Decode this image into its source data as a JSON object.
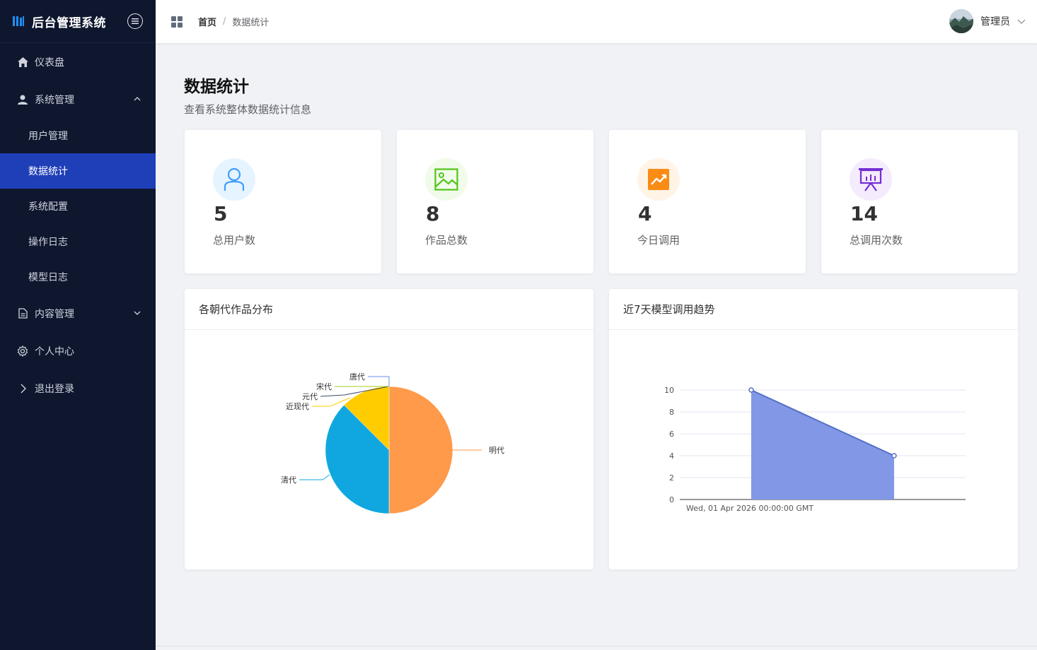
{
  "sidebar": {
    "brand_title": "后台管理系统",
    "menu": {
      "dashboard": "仪表盘",
      "system": "系统管理",
      "system_children": {
        "users": "用户管理",
        "stats": "数据统计",
        "config": "系统配置",
        "oplog": "操作日志",
        "modellog": "模型日志"
      },
      "content": "内容管理",
      "profile": "个人中心",
      "logout": "退出登录"
    },
    "active_item": "数据统计",
    "colors": {
      "background": "#0f172f",
      "active": "#1f3fb8"
    }
  },
  "header": {
    "breadcrumb": {
      "home": "首页",
      "separator": "/",
      "current": "数据统计"
    },
    "user": {
      "name": "管理员"
    }
  },
  "page": {
    "title": "数据统计",
    "subtitle": "查看系统整体数据统计信息"
  },
  "stats": [
    {
      "value": "5",
      "label": "总用户数",
      "icon": "user-icon",
      "color": "#409eff"
    },
    {
      "value": "8",
      "label": "作品总数",
      "icon": "picture-icon",
      "color": "#52c41a"
    },
    {
      "value": "4",
      "label": "今日调用",
      "icon": "trend-chart-icon",
      "color": "#fa8c16"
    },
    {
      "value": "14",
      "label": "总调用次数",
      "icon": "presentation-icon",
      "color": "#722ed1"
    }
  ],
  "chart_titles": {
    "pie": "各朝代作品分布",
    "line": "近7天模型调用趋势"
  },
  "chart_data": [
    {
      "type": "pie",
      "title": "各朝代作品分布",
      "categories": [
        "明代",
        "清代",
        "近现代",
        "元代",
        "宋代",
        "唐代"
      ],
      "values": [
        4,
        3,
        1,
        0,
        0,
        0
      ],
      "colors": [
        "#ff9a4a",
        "#10a7e0",
        "#ffcc00",
        "#3d4a66",
        "#9ccc1c",
        "#6b8ef0"
      ]
    },
    {
      "type": "area",
      "title": "近7天模型调用趋势",
      "x": [
        "Wed, 01 Apr 2026 00:00:00 GMT",
        ""
      ],
      "values": [
        10,
        4
      ],
      "ylim": [
        0,
        10
      ],
      "yticks": [
        "0",
        "2",
        "4",
        "6",
        "8",
        "10"
      ],
      "grid": true,
      "colors": {
        "line": "#5470c6",
        "fill": "#8297e5"
      }
    }
  ]
}
